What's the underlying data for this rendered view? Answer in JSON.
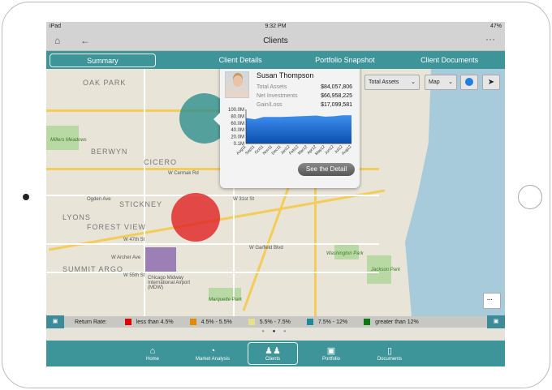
{
  "status": {
    "device": "iPad",
    "time": "9:32 PM",
    "battery": "47%"
  },
  "nav": {
    "title": "Clients",
    "more": "···"
  },
  "tabs": [
    "Summary",
    "Client Details",
    "Portfolio Snapshot",
    "Client Documents"
  ],
  "controls": {
    "metric": "Total Assets",
    "view": "Map"
  },
  "map_labels": {
    "oak_park": "OAK PARK",
    "berwyn": "BERWYN",
    "cicero": "CICERO",
    "millers": "Millers Meadows",
    "lyons": "LYONS",
    "stickney": "STICKNEY",
    "forest_view": "FOREST VIEW",
    "summit": "SUMMIT ARGO",
    "midway": "Chicago Midway International Airport (MDW)",
    "marquette": "Marquette Park",
    "washington": "Washington Park",
    "jackson": "Jackson Park",
    "cermak": "W Cermak Rd",
    "st31": "W 31st St",
    "st47": "W 47th St",
    "st55": "W 55th St",
    "garfield": "W Garfield Blvd",
    "archer": "W Archer Ave",
    "ogden": "Ogden Ave"
  },
  "popup": {
    "name": "Susan Thompson",
    "rows": [
      {
        "label": "Total Assets",
        "value": "$84,057,806"
      },
      {
        "label": "Net Investments",
        "value": "$66,958,225"
      },
      {
        "label": "Gain/Loss",
        "value": "$17,099,581"
      }
    ],
    "button": "See the Detail"
  },
  "chart_data": {
    "type": "area",
    "categories": [
      "Aug11",
      "Sep11",
      "Oct11",
      "Nov11",
      "Dec11",
      "Jan12",
      "Feb12",
      "Mar12",
      "Apr12",
      "May12",
      "Jun12",
      "Jul12",
      "Aug12"
    ],
    "values": [
      75,
      71,
      78,
      78,
      78,
      79,
      80,
      81,
      82,
      79,
      80,
      83,
      83
    ],
    "yticks": [
      "0.1M",
      "20.0M",
      "40.0M",
      "60.0M",
      "80.0M",
      "100.0M"
    ],
    "ylim": [
      0,
      100
    ],
    "color": "#1f6fd6"
  },
  "legend": {
    "title": "Return Rate:",
    "items": [
      {
        "label": "less than 4.5%",
        "color": "#e00000"
      },
      {
        "label": "4.5% - 5.5%",
        "color": "#e38a00"
      },
      {
        "label": "5.5% - 7.5%",
        "color": "#e6e08a"
      },
      {
        "label": "7.5% - 12%",
        "color": "#1f8a9a"
      },
      {
        "label": "greater than 12%",
        "color": "#0a7a10"
      }
    ]
  },
  "bubbles": [
    {
      "color": "#2d8f8f"
    },
    {
      "color": "#e02020"
    }
  ],
  "bottom_tabs": [
    {
      "label": "Home",
      "icon": "⌂"
    },
    {
      "label": "Market Analysis",
      "icon": "◔"
    },
    {
      "label": "Clients",
      "icon": "♟♟"
    },
    {
      "label": "Portfolio",
      "icon": "▣"
    },
    {
      "label": "Documents",
      "icon": "▯"
    }
  ]
}
